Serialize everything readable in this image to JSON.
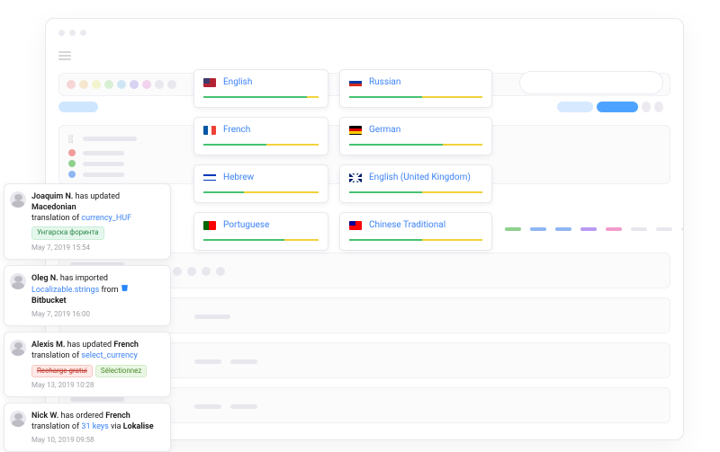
{
  "languages": [
    {
      "code": "en",
      "name": "English",
      "progress": {
        "green": 0.9,
        "yellow": 0.1
      }
    },
    {
      "code": "ru",
      "name": "Russian",
      "progress": {
        "green": 0.55,
        "yellow": 0.45
      }
    },
    {
      "code": "fr",
      "name": "French",
      "progress": {
        "green": 0.55,
        "yellow": 0.45
      }
    },
    {
      "code": "de",
      "name": "German",
      "progress": {
        "green": 0.7,
        "yellow": 0.3
      }
    },
    {
      "code": "il",
      "name": "Hebrew",
      "progress": {
        "green": 0.35,
        "yellow": 0.65
      }
    },
    {
      "code": "gb",
      "name": "English (United Kingdom)",
      "progress": {
        "green": 0.55,
        "yellow": 0.45
      }
    },
    {
      "code": "pt",
      "name": "Portuguese",
      "progress": {
        "green": 0.7,
        "yellow": 0.3
      }
    },
    {
      "code": "tw",
      "name": "Chinese Traditional",
      "progress": {
        "green": 0.55,
        "yellow": 0.45
      }
    }
  ],
  "feed": [
    {
      "user": "Joaquim N.",
      "action": "has updated",
      "subject": "Macedonian",
      "line2_prefix": "translation of",
      "key": "currency_HUF",
      "pills": [
        {
          "text": "Унгарска форинта",
          "cls": "green"
        }
      ],
      "ts": "May 7, 2019 15:54"
    },
    {
      "user": "Oleg N.",
      "action": "has imported",
      "subject": "",
      "link": "Localizable.strings",
      "from": "from",
      "source_icon": "bitbucket",
      "source": "Bitbucket",
      "ts": "May 7, 2019 16:00"
    },
    {
      "user": "Alexis M.",
      "action": "has updated",
      "subject": "French",
      "line2_prefix": "translation of",
      "key": "select_currency",
      "pills": [
        {
          "text": "Recharge gratui",
          "cls": "red-out"
        },
        {
          "text": "Sélectionnez",
          "cls": "green2"
        }
      ],
      "ts": "May 13, 2019 10:28"
    },
    {
      "user": "Nick W.",
      "action": "has ordered",
      "subject": "French",
      "line2_prefix": "translation of",
      "key": "31 keys",
      "via": "via",
      "via_target": "Lokalise",
      "ts": "May 10, 2019 09:58"
    }
  ],
  "palette": {
    "dots": [
      "#f6d5d5",
      "#f6e7cf",
      "#f3f3cf",
      "#d7f0d3",
      "#cfe6f5",
      "#d8d3f3",
      "#f1d3ed",
      "#e8e8ee",
      "#e8e8ee"
    ]
  }
}
